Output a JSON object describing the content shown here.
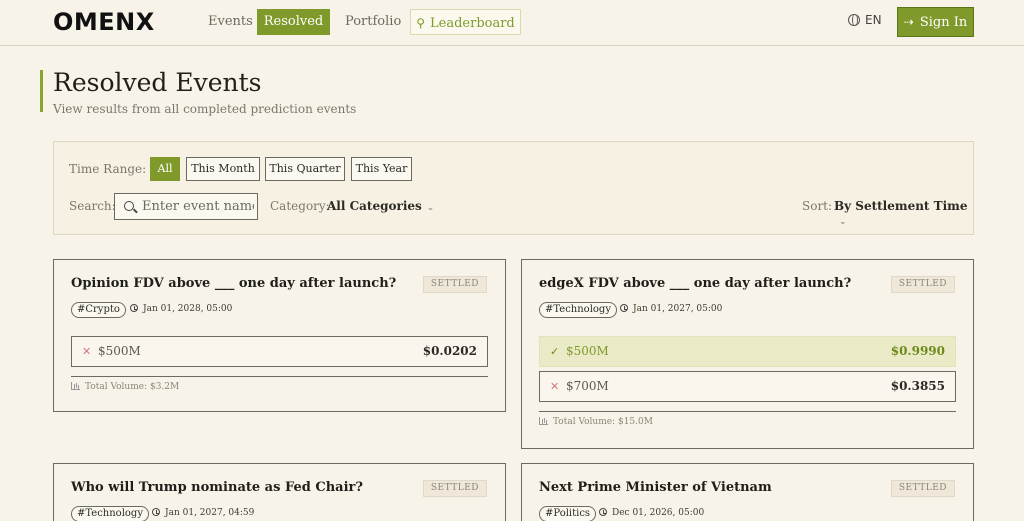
{
  "brand": {
    "logo": "OMENX"
  },
  "nav": {
    "events": "Events",
    "resolved": "Resolved",
    "portfolio": "Portfolio",
    "leaderboard": "Leaderboard",
    "leaderboard_icon": "trophy-icon",
    "language": "EN",
    "signin": "Sign In"
  },
  "page": {
    "title": "Resolved Events",
    "subtitle": "View results from all completed prediction events"
  },
  "filters": {
    "time_range_label": "Time Range:",
    "time_options": [
      "All",
      "This Month",
      "This Quarter",
      "This Year"
    ],
    "time_selected": "All",
    "search_label": "Search:",
    "search_placeholder": "Enter event name",
    "category_label": "Category:",
    "category_value": "All Categories",
    "sort_label": "Sort:",
    "sort_value": "By Settlement Time"
  },
  "colors": {
    "accent": "#7f9a2a",
    "background": "#f8f3e8",
    "loss_mark": "#d17a7a"
  },
  "events": [
    {
      "title": "Opinion FDV above ___ one day after launch?",
      "status": "SETTLED",
      "tag": "#Crypto",
      "date": "Jan 01, 2028, 05:00",
      "outcomes": [
        {
          "name": "$500M",
          "price": "$0.0202",
          "won": false
        }
      ],
      "volume": "Total Volume: $3.2M"
    },
    {
      "title": "edgeX FDV above ___ one day after launch?",
      "status": "SETTLED",
      "tag": "#Technology",
      "date": "Jan 01, 2027, 05:00",
      "outcomes": [
        {
          "name": "$500M",
          "price": "$0.9990",
          "won": true
        },
        {
          "name": "$700M",
          "price": "$0.3855",
          "won": false
        }
      ],
      "volume": "Total Volume: $15.0M"
    },
    {
      "title": "Who will Trump nominate as Fed Chair?",
      "status": "SETTLED",
      "tag": "#Technology",
      "date": "Jan 01, 2027, 04:59"
    },
    {
      "title": "Next Prime Minister of Vietnam",
      "status": "SETTLED",
      "tag": "#Politics",
      "date": "Dec 01, 2026, 05:00"
    }
  ]
}
